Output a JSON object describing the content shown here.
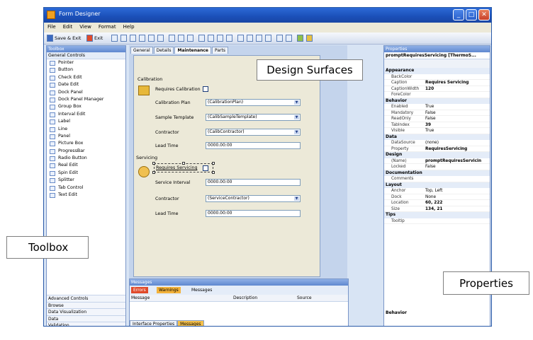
{
  "window": {
    "title": "Form Designer"
  },
  "menu": [
    "File",
    "Edit",
    "View",
    "Format",
    "Help"
  ],
  "toolbar": {
    "save_exit": "Save & Exit",
    "exit": "Exit"
  },
  "toolbox": {
    "title": "Toolbox",
    "group": "General Controls",
    "items": [
      "Pointer",
      "Button",
      "Check Edit",
      "Date Edit",
      "Dock Panel",
      "Dock Panel Manager",
      "Group Box",
      "Interval Edit",
      "Label",
      "Line",
      "Panel",
      "Picture Box",
      "ProgressBar",
      "Radio Button",
      "Real Edit",
      "Spin Edit",
      "Splitter",
      "Tab Control",
      "Text Edit"
    ],
    "bottom_groups": [
      "Advanced Controls",
      "Browse",
      "Data Visualization",
      "Data",
      "Validation"
    ]
  },
  "designer": {
    "tabs": [
      "General",
      "Details",
      "Maintenance",
      "Parts"
    ],
    "active_tab": "Maintenance",
    "calibration": {
      "group": "Calibration",
      "requires_label": "Requires Calibration",
      "plan_label": "Calibration Plan",
      "plan_value": "(CalibrationPlan)",
      "sample_label": "Sample Template",
      "sample_value": "(CalibSampleTemplate)",
      "contractor_label": "Contractor",
      "contractor_value": "(CalibContractor)",
      "lead_label": "Lead Time",
      "lead_value": "0000.00:00"
    },
    "servicing": {
      "group": "Servicing",
      "requires_label": "Requires Servicing",
      "interval_label": "Service Interval",
      "interval_value": "0000.00:00",
      "contractor_label": "Contractor",
      "contractor_value": "(ServiceContractor)",
      "lead_label": "Lead Time",
      "lead_value": "0000.00:00"
    }
  },
  "messages": {
    "title": "Messages",
    "errors": "Errors",
    "warnings": "Warnings",
    "messages": "Messages",
    "columns": [
      "Message",
      "Description",
      "Source"
    ],
    "bottom_tabs": [
      "Interface Properties",
      "Messages"
    ]
  },
  "properties": {
    "title": "Properties",
    "object": "promptRequiresServicing [ThermoS...",
    "rows": [
      {
        "cat": "Appearance"
      },
      {
        "name": "BackColor",
        "value": ""
      },
      {
        "name": "Caption",
        "value": "Requires Servicing",
        "bold": true
      },
      {
        "name": "CaptionWidth",
        "value": "120",
        "bold": true
      },
      {
        "name": "ForeColor",
        "value": ""
      },
      {
        "cat": "Behavior"
      },
      {
        "name": "Enabled",
        "value": "True"
      },
      {
        "name": "Mandatory",
        "value": "False"
      },
      {
        "name": "ReadOnly",
        "value": "False"
      },
      {
        "name": "TabIndex",
        "value": "39",
        "bold": true
      },
      {
        "name": "Visible",
        "value": "True"
      },
      {
        "cat": "Data"
      },
      {
        "name": "DataSource",
        "value": "(none)"
      },
      {
        "name": "Property",
        "value": "RequiresServicing",
        "bold": true
      },
      {
        "cat": "Design"
      },
      {
        "name": "(Name)",
        "value": "promptRequiresServicin",
        "bold": true
      },
      {
        "name": "Locked",
        "value": "False"
      },
      {
        "cat": "Documentation"
      },
      {
        "name": "Comments",
        "value": ""
      },
      {
        "cat": "Layout"
      },
      {
        "name": "Anchor",
        "value": "Top, Left"
      },
      {
        "name": "Dock",
        "value": "None"
      },
      {
        "name": "Location",
        "value": "60, 222",
        "bold": true
      },
      {
        "name": "Size",
        "value": "134, 21",
        "bold": true
      },
      {
        "cat": "Tips"
      },
      {
        "name": "Tooltip",
        "value": ""
      }
    ],
    "description": "Behavior"
  },
  "callouts": {
    "toolbox": "Toolbox",
    "design": "Design Surfaces",
    "properties": "Properties"
  }
}
